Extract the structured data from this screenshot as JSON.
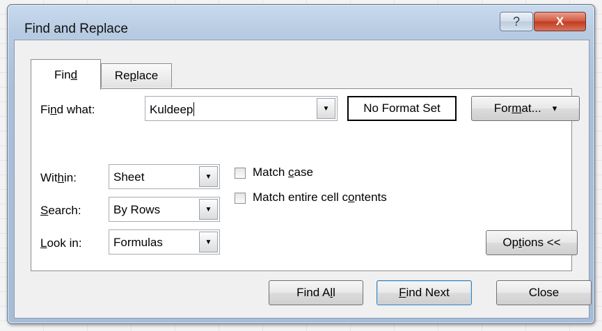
{
  "window": {
    "title": "Find and Replace",
    "help_glyph": "?",
    "close_glyph": "X"
  },
  "tabs": [
    {
      "label_pre": "Fin",
      "label_ul": "d",
      "label_post": "",
      "selected": true
    },
    {
      "label_pre": "Re",
      "label_ul": "p",
      "label_post": "lace",
      "selected": false
    }
  ],
  "find": {
    "label_pre": "Fi",
    "label_ul": "n",
    "label_post": "d what:",
    "value": "Kuldeep",
    "format_status": "No Format Set",
    "format_button_pre": "For",
    "format_button_ul": "m",
    "format_button_post": "at...",
    "format_button_arrow": "▾"
  },
  "options": {
    "within": {
      "label_pre": "Wit",
      "label_ul": "h",
      "label_post": "in:",
      "value": "Sheet"
    },
    "search": {
      "label_pre": "",
      "label_ul": "S",
      "label_post": "earch:",
      "value": "By Rows"
    },
    "look_in": {
      "label_pre": "",
      "label_ul": "L",
      "label_post": "ook in:",
      "value": "Formulas"
    },
    "match_case": {
      "label_pre": "Match ",
      "label_ul": "c",
      "label_post": "ase",
      "checked": false
    },
    "match_entire": {
      "label_pre": "Match entire cell c",
      "label_ul": "o",
      "label_post": "ntents",
      "checked": false
    },
    "options_button_pre": "Op",
    "options_button_ul": "t",
    "options_button_post": "ions <<"
  },
  "buttons": {
    "find_all_pre": "Find A",
    "find_all_ul": "l",
    "find_all_post": "l",
    "find_next_pre": "",
    "find_next_ul": "F",
    "find_next_post": "ind Next",
    "close": "Close"
  },
  "dropdown_arrow": "▼"
}
